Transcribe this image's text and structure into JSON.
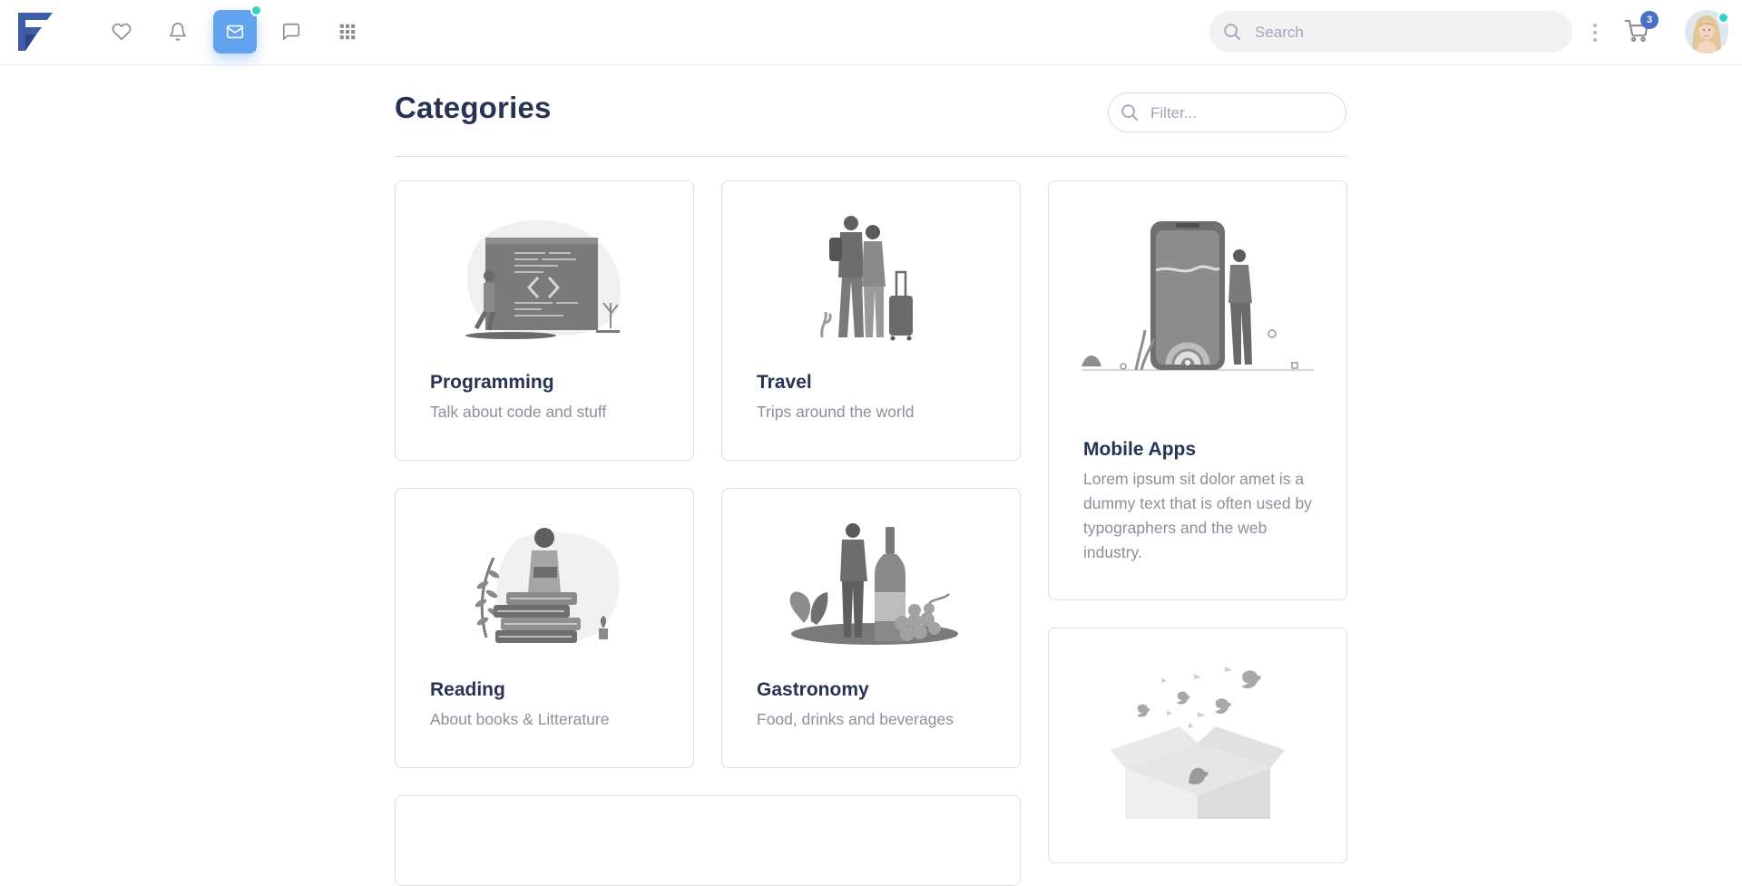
{
  "navbar": {
    "logo_letter": "F",
    "search_placeholder": "Search",
    "cart_count": "3",
    "accent_color": "#63a4ef",
    "online_color": "#38d1c5",
    "icons": [
      "heart-icon",
      "bell-icon",
      "mail-icon",
      "chat-icon",
      "apps-grid-icon"
    ]
  },
  "page": {
    "title": "Categories",
    "filter_placeholder": "Filter..."
  },
  "categories": [
    {
      "title": "Programming",
      "description": "Talk about code and stuff"
    },
    {
      "title": "Travel",
      "description": "Trips around the world"
    },
    {
      "title": "Mobile Apps",
      "description": "Lorem ipsum sit dolor amet is a dummy text that is often used by typographers and the web industry."
    },
    {
      "title": "Reading",
      "description": "About books & Litterature"
    },
    {
      "title": "Gastronomy",
      "description": "Food, drinks and beverages"
    }
  ]
}
